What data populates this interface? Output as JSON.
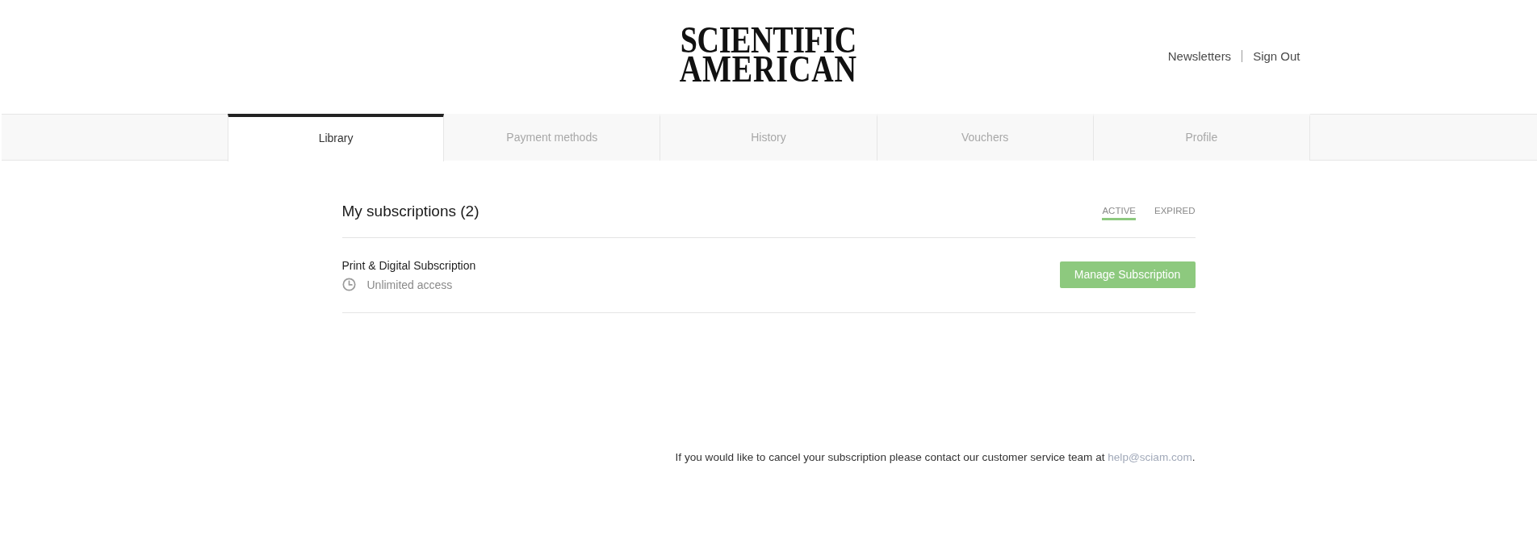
{
  "logo": {
    "lines": [
      "SCIENTIFIC",
      "AMERICAN"
    ]
  },
  "header_nav": [
    {
      "label": "Newsletters"
    },
    {
      "label": "Sign Out"
    }
  ],
  "tabs": [
    {
      "label": "Library",
      "selected": true
    },
    {
      "label": "Payment methods",
      "selected": false
    },
    {
      "label": "History",
      "selected": false
    },
    {
      "label": "Vouchers",
      "selected": false
    },
    {
      "label": "Profile",
      "selected": false
    }
  ],
  "subscriptions": {
    "title": "My subscriptions (2)",
    "filters": [
      {
        "label": "ACTIVE",
        "selected": true
      },
      {
        "label": "EXPIRED",
        "selected": false
      }
    ],
    "items": [
      {
        "name": "Print & Digital Subscription",
        "access": "Unlimited access",
        "action": "Manage Subscription"
      }
    ]
  },
  "footer": {
    "text": "If you would like to cancel your subscription please contact our customer service team at",
    "link": "help@sciam.com",
    "suffix": "."
  }
}
